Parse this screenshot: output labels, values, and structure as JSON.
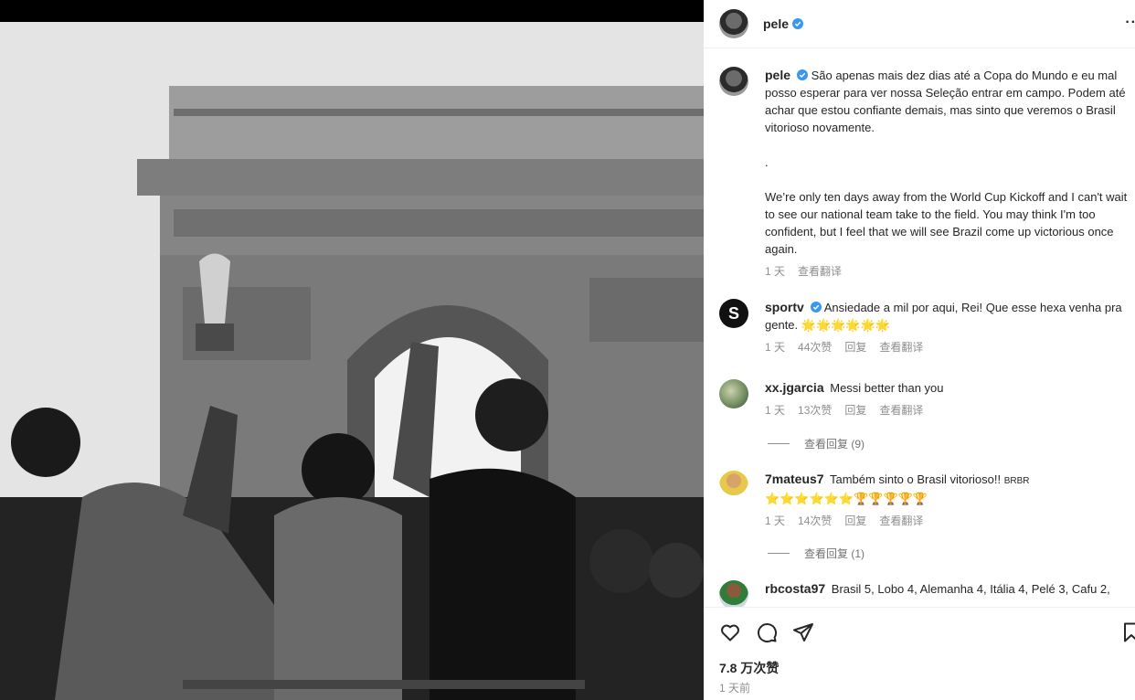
{
  "post": {
    "username": "pele",
    "caption_pt": "São apenas mais dez dias até a Copa do Mundo e eu mal posso esperar para ver nossa Seleção entrar em campo. Podem até achar que estou confiante demais, mas sinto que veremos o Brasil vitorioso novamente.",
    "caption_dot": ".",
    "caption_en": "We’re only ten days away from the World Cup Kickoff and I can't wait to see our national team take to the field. You may think I'm too confident, but I feel that we will see Brazil come up victorious once again.",
    "time": "1 天",
    "translate": "查看翻译",
    "likes": "7.8 万次赞",
    "posted": "1 天前"
  },
  "comments": [
    {
      "username": "sportv",
      "verified": true,
      "text": "Ansiedade a mil por aqui, Rei! Que esse hexa venha pra gente.",
      "emoji": "🌟🌟🌟🌟🌟🌟",
      "time": "1 天",
      "likes": "44次赞",
      "reply": "回复",
      "translate": "查看翻译"
    },
    {
      "username": "xx.jgarcia",
      "text": "Messi better than you",
      "time": "1 天",
      "likes": "13次赞",
      "reply": "回复",
      "translate": "查看翻译",
      "view_replies": "查看回复 (9)"
    },
    {
      "username": "7mateus7",
      "text": "Também sinto o Brasil vitorioso!! ",
      "suffix": "BRBR",
      "emoji": "⭐⭐⭐⭐⭐⭐🏆🏆🏆🏆🏆",
      "time": "1 天",
      "likes": "14次赞",
      "reply": "回复",
      "translate": "查看翻译",
      "view_replies": "查看回复 (1)"
    },
    {
      "username": "rbcosta97",
      "text": "Brasil 5, Lobo 4, Alemanha 4, Itália 4, Pelé 3, Cafu 2,"
    }
  ],
  "icons": {
    "like": "heart-icon",
    "comment": "comment-icon",
    "share": "paper-plane-icon",
    "save": "bookmark-icon",
    "more": "more-options-icon",
    "verified": "verified-badge-icon"
  },
  "colors": {
    "verified": "#3897f0",
    "text": "#262626",
    "muted": "#8e8e8e"
  }
}
